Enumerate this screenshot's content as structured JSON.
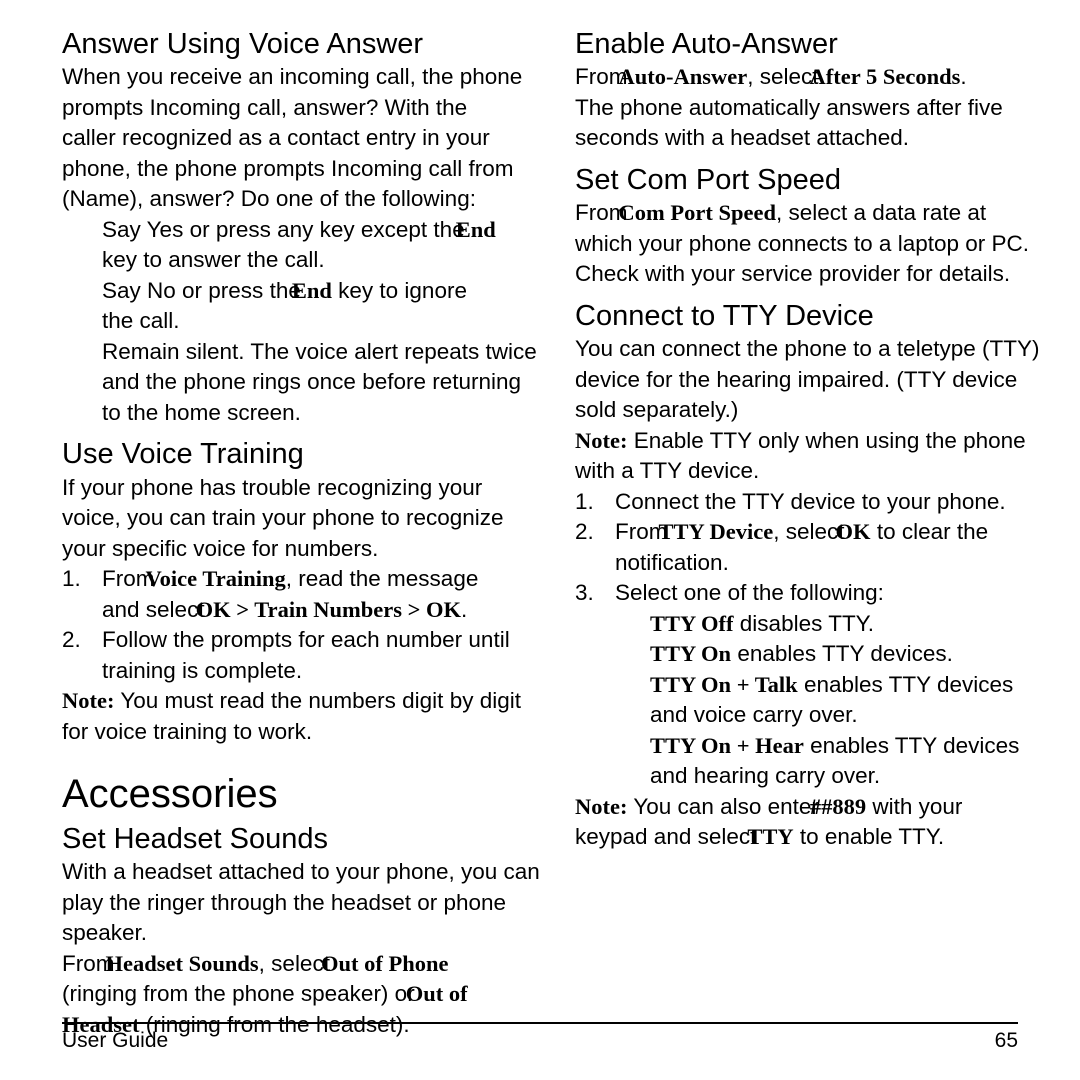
{
  "document": {
    "type": "user-guide-page",
    "footer": {
      "left_label": "User Guide",
      "page_number": "65"
    }
  },
  "left_column": {
    "s1": {
      "heading": "Answer Using Voice Answer",
      "p1_l1": "When you receive an incoming call, the phone",
      "p1_l2": "prompts  Incoming call, answer?  With the",
      "p1_l3": "caller recognized as a contact entry in your",
      "p1_l4": "phone, the phone prompts  Incoming call from",
      "p1_l5": "(Name), answer?  Do one of the following:",
      "b1_l1a": "Say  Yes  or press any key except the",
      "b1_l1b": "End",
      "b1_l2": "key to answer the call.",
      "b2_l1a": "Say  No  or press the",
      "b2_l1b": "End",
      "b2_l1c": " key to ignore",
      "b2_l2": "the call.",
      "b3_l1": "Remain silent. The voice alert repeats twice",
      "b3_l2": "and the phone rings once before returning",
      "b3_l3": "to the home screen."
    },
    "s2": {
      "heading": "Use Voice Training",
      "p1_l1": "If your phone has trouble recognizing your",
      "p1_l2": "voice, you can train your phone to recognize",
      "p1_l3": "your specific voice for numbers.",
      "step1_num": "1.",
      "step1_l1a": "From",
      "step1_l1b": "Voice Training",
      "step1_l1c": ", read the message",
      "step1_l2a": "and select",
      "step1_l2b": "OK > Train Numbers > OK",
      "step1_l2c": ".",
      "step2_num": "2.",
      "step2_l1": "Follow the prompts for each number until",
      "step2_l2": "training is complete.",
      "note_lbl": "Note:",
      "note_l1": " You must read the numbers digit by digit",
      "note_l2": "for voice training to work."
    },
    "s3": {
      "chapter": "Accessories",
      "heading": "Set Headset Sounds",
      "p1_l1": "With a headset attached to your phone, you can",
      "p1_l2": "play the ringer through the headset or phone",
      "p1_l3": "speaker.",
      "p2_l1a": "From",
      "p2_l1b": "Headset Sounds",
      "p2_l1c": ", select",
      "p2_l1d": "Out of Phone",
      "p2_l2a": "(ringing from the phone speaker) or",
      "p2_l2b": "Out of",
      "p2_l3a": "Headset",
      "p2_l3b": " (ringing from the headset)."
    }
  },
  "right_column": {
    "s1": {
      "heading": "Enable Auto-Answer",
      "p1_l1a": "From",
      "p1_l1b": "Auto-Answer",
      "p1_l1c": ", select",
      "p1_l1d": "After 5 Seconds",
      "p1_l1e": ".",
      "p1_l2": "The phone automatically answers after five",
      "p1_l3": "seconds with a headset attached."
    },
    "s2": {
      "heading": "Set Com Port Speed",
      "p1_l1a": "From",
      "p1_l1b": "Com Port Speed",
      "p1_l1c": ", select a data rate at",
      "p1_l2": "which your phone connects to a laptop or PC.",
      "p1_l3": "Check with your service provider for details."
    },
    "s3": {
      "heading": "Connect to TTY Device",
      "p1_l1": "You can connect the phone to a teletype (TTY)",
      "p1_l2": "device for the hearing impaired. (TTY device",
      "p1_l3": "sold separately.)",
      "note_lbl": "Note:",
      "note_l1": " Enable TTY only when using the phone",
      "note_l2": "with a TTY device.",
      "step1_num": "1.",
      "step1_l1": "Connect the TTY device to your phone.",
      "step2_num": "2.",
      "step2_l1a": "From",
      "step2_l1b": "TTY Device",
      "step2_l1c": ", select",
      "step2_l1d": "OK",
      "step2_l1e": " to clear the",
      "step2_l2": "notification.",
      "step3_num": "3.",
      "step3_l1": "Select one of the following:",
      "opt1_b": "TTY Off",
      "opt1_t": " disables TTY.",
      "opt2_b": "TTY On",
      "opt2_t": " enables TTY devices.",
      "opt3_b": "TTY On + Talk",
      "opt3_t": " enables TTY devices",
      "opt3_l2": "and voice carry over.",
      "opt4_b": "TTY On + Hear",
      "opt4_t": " enables TTY devices",
      "opt4_l2": "and hearing carry over.",
      "note2_lbl": "Note:",
      "note2_l1a": " You can also enter",
      "note2_l1b": "##889",
      "note2_l1c": " with your",
      "note2_l2a": "keypad and select",
      "note2_l2b": "TTY",
      "note2_l2c": " to enable TTY."
    }
  }
}
